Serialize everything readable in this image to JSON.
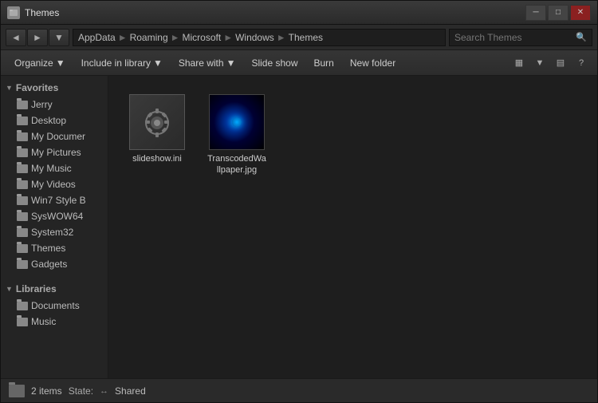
{
  "window": {
    "title": "Themes",
    "controls": {
      "minimize": "─",
      "maximize": "□",
      "close": "✕"
    }
  },
  "address": {
    "back_label": "◄",
    "forward_label": "►",
    "dropdown_label": "▼",
    "breadcrumb": [
      {
        "label": "AppData",
        "sep": "►"
      },
      {
        "label": "Roaming",
        "sep": "►"
      },
      {
        "label": "Microsoft",
        "sep": "►"
      },
      {
        "label": "Windows",
        "sep": "►"
      },
      {
        "label": "Themes",
        "sep": ""
      }
    ],
    "search_placeholder": "Search Themes",
    "search_icon": "🔍"
  },
  "toolbar": {
    "organize_label": "Organize",
    "include_library_label": "Include in library",
    "share_with_label": "Share with",
    "slide_show_label": "Slide show",
    "burn_label": "Burn",
    "new_folder_label": "New folder",
    "dropdown_arrow": "▼",
    "view_icon_1": "▦",
    "view_icon_2": "▤",
    "help_icon": "?"
  },
  "sidebar": {
    "favorites_label": "Favorites",
    "favorites_arrow": "▼",
    "items": [
      {
        "label": "Jerry",
        "id": "jerry"
      },
      {
        "label": "Desktop",
        "id": "desktop"
      },
      {
        "label": "My Documer",
        "id": "my-documents"
      },
      {
        "label": "My Pictures",
        "id": "my-pictures"
      },
      {
        "label": "My Music",
        "id": "my-music"
      },
      {
        "label": "My Videos",
        "id": "my-videos"
      },
      {
        "label": "Win7 Style B",
        "id": "win7-style"
      },
      {
        "label": "SysWOW64",
        "id": "syswow64"
      },
      {
        "label": "System32",
        "id": "system32"
      },
      {
        "label": "Themes",
        "id": "themes"
      },
      {
        "label": "Gadgets",
        "id": "gadgets"
      }
    ],
    "libraries_label": "Libraries",
    "libraries_arrow": "▼",
    "library_items": [
      {
        "label": "Documents",
        "id": "documents"
      },
      {
        "label": "Music",
        "id": "music"
      }
    ]
  },
  "files": [
    {
      "id": "slideshow-ini",
      "name": "slideshow.ini",
      "type": "ini",
      "thumbnail_icon": "⚙"
    },
    {
      "id": "transcoded-wallpaper",
      "name": "TranscodedWallpaper.jpg",
      "type": "jpg"
    }
  ],
  "status": {
    "item_count": "2 items",
    "state_label": "State:",
    "shared_icon": "↔",
    "shared_label": "Shared"
  }
}
